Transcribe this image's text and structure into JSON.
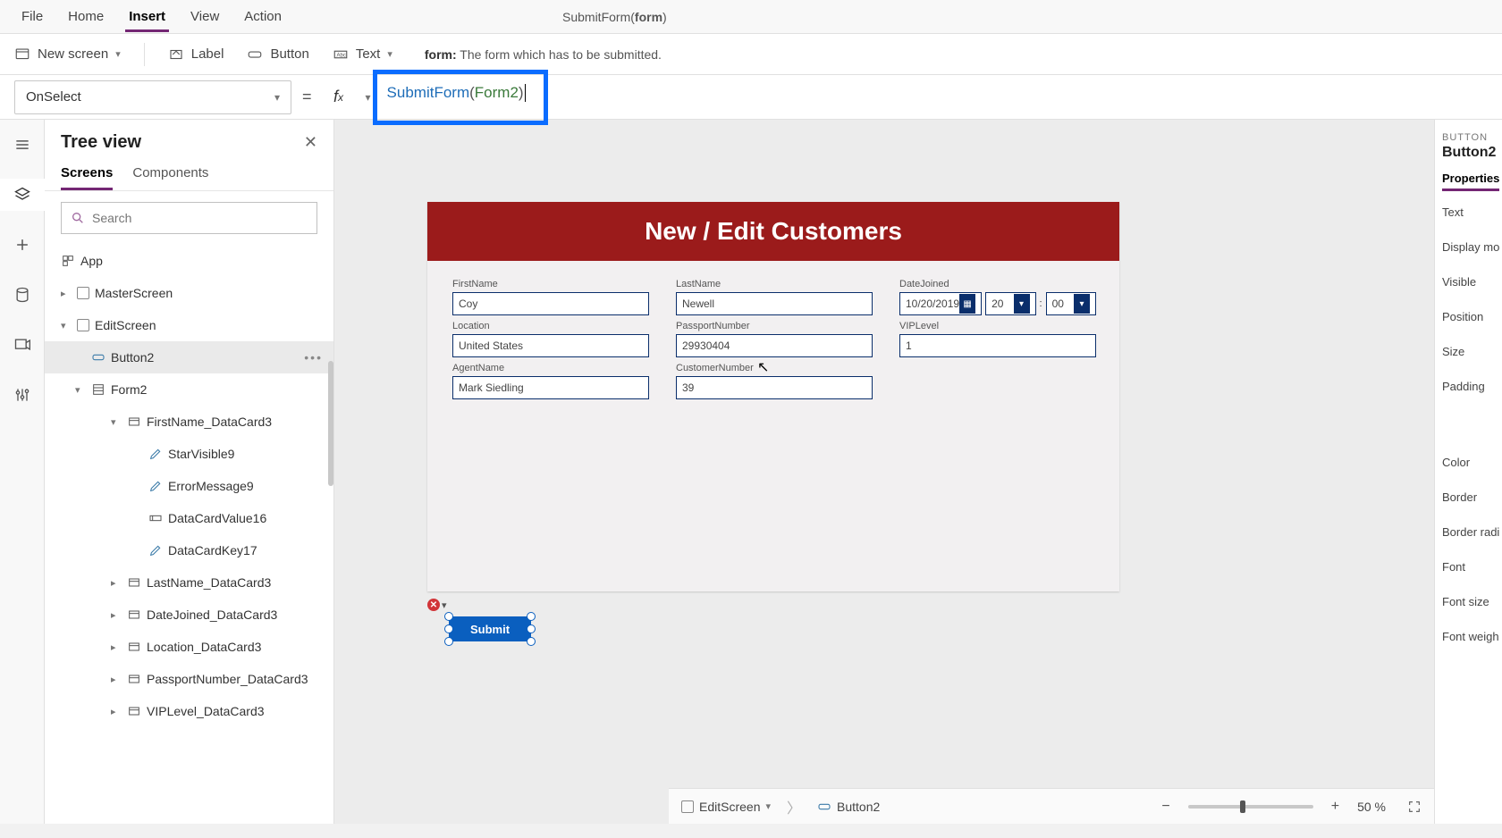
{
  "menubar": {
    "items": [
      "File",
      "Home",
      "Insert",
      "View",
      "Action"
    ],
    "active": "Insert",
    "signature": "SubmitForm(form)"
  },
  "ribbon": {
    "newscreen": "New screen",
    "label": "Label",
    "button": "Button",
    "text": "Text",
    "hint_key": "form:",
    "hint_text": "The form which has to be submitted."
  },
  "formula": {
    "property": "OnSelect",
    "fn": "SubmitForm",
    "arg": "Form2"
  },
  "tree": {
    "title": "Tree view",
    "tabs": [
      "Screens",
      "Components"
    ],
    "active_tab": "Screens",
    "search_placeholder": "Search",
    "items": {
      "app": "App",
      "master": "MasterScreen",
      "edit": "EditScreen",
      "button2": "Button2",
      "form2": "Form2",
      "firstname": "FirstName_DataCard3",
      "star": "StarVisible9",
      "error": "ErrorMessage9",
      "value": "DataCardValue16",
      "key": "DataCardKey17",
      "lastname": "LastName_DataCard3",
      "datejoined": "DateJoined_DataCard3",
      "location": "Location_DataCard3",
      "passport": "PassportNumber_DataCard3",
      "vip": "VIPLevel_DataCard3"
    }
  },
  "canvas": {
    "header": "New / Edit Customers",
    "fields": {
      "firstname": {
        "label": "FirstName",
        "value": "Coy"
      },
      "lastname": {
        "label": "LastName",
        "value": "Newell"
      },
      "datejoined": {
        "label": "DateJoined",
        "value": "10/20/2019",
        "hour": "20",
        "min": "00"
      },
      "location": {
        "label": "Location",
        "value": "United States"
      },
      "passport": {
        "label": "PassportNumber",
        "value": "29930404"
      },
      "vip": {
        "label": "VIPLevel",
        "value": "1"
      },
      "agent": {
        "label": "AgentName",
        "value": "Mark Siedling"
      },
      "customer": {
        "label": "CustomerNumber",
        "value": "39"
      }
    },
    "submit": "Submit"
  },
  "props": {
    "type": "BUTTON",
    "name": "Button2",
    "tab": "Properties",
    "labels": [
      "Text",
      "Display mo",
      "Visible",
      "Position",
      "Size",
      "Padding",
      "Color",
      "Border",
      "Border radi",
      "Font",
      "Font size",
      "Font weigh"
    ]
  },
  "bottom": {
    "crumb_screen": "EditScreen",
    "crumb_ctrl": "Button2",
    "zoom": "50",
    "zoom_unit": "%"
  }
}
